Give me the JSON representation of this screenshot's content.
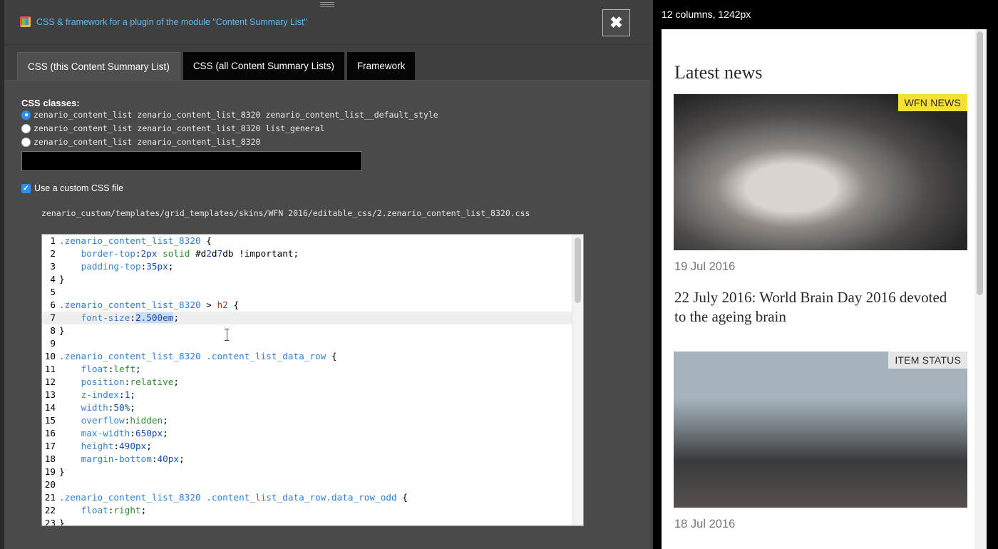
{
  "dialog": {
    "title": "CSS & framework for a plugin of the module \"Content Summary List\"",
    "close_label": "✖",
    "tabs": [
      {
        "label": "CSS (this Content Summary List)",
        "active": true
      },
      {
        "label": "CSS (all Content Summary Lists)",
        "active": false
      },
      {
        "label": "Framework",
        "active": false
      }
    ],
    "css_classes_label": "CSS classes:",
    "class_options": [
      {
        "label": "zenario_content_list zenario_content_list_8320 zenario_content_list__default_style",
        "selected": true
      },
      {
        "label": "zenario_content_list zenario_content_list_8320 list_general",
        "selected": false
      },
      {
        "label": "zenario_content_list zenario_content_list_8320",
        "selected": false
      }
    ],
    "custom_class_value": "",
    "use_custom_css_label": "Use a custom CSS file",
    "use_custom_css_checked": true,
    "file_path": "zenario_custom/templates/grid_templates/skins/WFN 2016/editable_css/2.zenario_content_list_8320.css"
  },
  "editor": {
    "active_line": 7,
    "lines": [
      {
        "n": "1",
        "text": ".zenario_content_list_8320 {"
      },
      {
        "n": "2",
        "text": "    border-top:2px solid #d2d7db !important;"
      },
      {
        "n": "3",
        "text": "    padding-top:35px;"
      },
      {
        "n": "4",
        "text": "}"
      },
      {
        "n": "5",
        "text": ""
      },
      {
        "n": "6",
        "text": ".zenario_content_list_8320 > h2 {"
      },
      {
        "n": "7",
        "text": "    font-size:2.500em;"
      },
      {
        "n": "8",
        "text": "}"
      },
      {
        "n": "9",
        "text": ""
      },
      {
        "n": "10",
        "text": ".zenario_content_list_8320 .content_list_data_row {"
      },
      {
        "n": "11",
        "text": "    float:left;"
      },
      {
        "n": "12",
        "text": "    position:relative;"
      },
      {
        "n": "13",
        "text": "    z-index:1;"
      },
      {
        "n": "14",
        "text": "    width:50%;"
      },
      {
        "n": "15",
        "text": "    overflow:hidden;"
      },
      {
        "n": "16",
        "text": "    max-width:650px;"
      },
      {
        "n": "17",
        "text": "    height:490px;"
      },
      {
        "n": "18",
        "text": "    margin-bottom:40px;"
      },
      {
        "n": "19",
        "text": "}"
      },
      {
        "n": "20",
        "text": ""
      },
      {
        "n": "21",
        "text": ".zenario_content_list_8320 .content_list_data_row.data_row_odd {"
      },
      {
        "n": "22",
        "text": "    float:right;"
      },
      {
        "n": "23",
        "text": "}"
      }
    ]
  },
  "preview": {
    "grid_info": "12 columns, 1242px",
    "heading": "Latest news",
    "items": [
      {
        "badge": "WFN NEWS",
        "date": "19 Jul 2016",
        "title": "22 July 2016: World Brain Day 2016 devoted to the ageing brain"
      },
      {
        "badge": "ITEM STATUS",
        "date": "18 Jul 2016",
        "title": ""
      }
    ]
  },
  "colors": {
    "accent_blue": "#2b8ff5",
    "title_blue": "#5bb8f5",
    "badge_yellow": "#f7df33"
  }
}
